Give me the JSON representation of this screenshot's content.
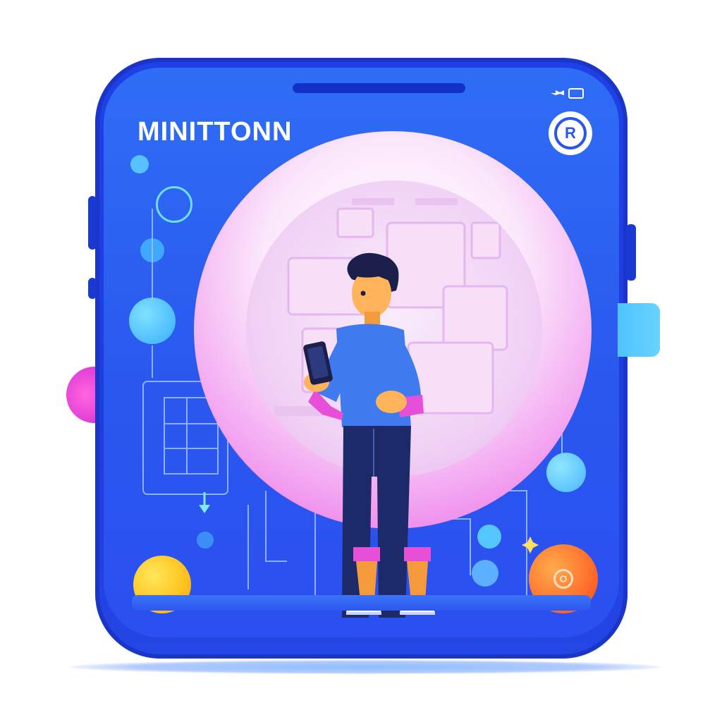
{
  "app": {
    "brand_title": "MINITTONN",
    "badge_letter": "R"
  },
  "colors": {
    "device_blue": "#1f40e8",
    "screen_blue": "#2a58ee",
    "accent_pink": "#e761e5",
    "accent_cyan": "#5fcbff",
    "accent_yellow": "#ffc21f",
    "accent_orange": "#ff6a2a"
  },
  "icons": {
    "status": [
      "signal-icon",
      "battery-icon"
    ],
    "badge": "registered-icon",
    "target": "target-icon",
    "arrow": "arrow-down-icon",
    "sparkle": "sparkle-icon"
  }
}
